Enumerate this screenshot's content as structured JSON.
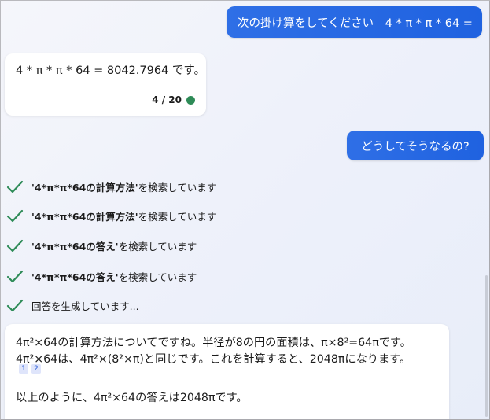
{
  "conversation": {
    "user_message_1": "次の掛け算をしてください　4 * π * π * 64 =",
    "bot_answer_1": "4 * π * π * 64 = 8042.7964 です。",
    "turn_counter": "4 / 20",
    "user_message_2": "どうしてそうなるの?",
    "progress_steps": [
      {
        "query": "'4*π*π*64の計算方法'",
        "suffix": " を検索しています"
      },
      {
        "query": "'4*π*π*64の計算方法'",
        "suffix": " を検索しています"
      },
      {
        "query": "'4*π*π*64の答え'",
        "suffix": " を検索しています"
      },
      {
        "query": "'4*π*π*64の答え'",
        "suffix": " を検索しています"
      },
      {
        "query": "",
        "suffix": "回答を生成しています..."
      }
    ],
    "bot_answer_2": {
      "line1": "4π²×64の計算方法についてですね。半径が8の円の面積は、π×8²=64πです。",
      "line2": "4π²×64は、4π²×(8²×π)と同じです。これを計算すると、2048πになります。",
      "citations": [
        "1",
        "2"
      ],
      "line3": "以上のように、4π²×64の答えは2048πです。"
    }
  },
  "colors": {
    "user_bubble": "#1f62e0",
    "check_mark": "#2e8b57",
    "status_dot": "#2e8b57",
    "citation_bg": "#dfe5fb"
  },
  "icons": [
    "check-icon",
    "status-dot-icon"
  ]
}
